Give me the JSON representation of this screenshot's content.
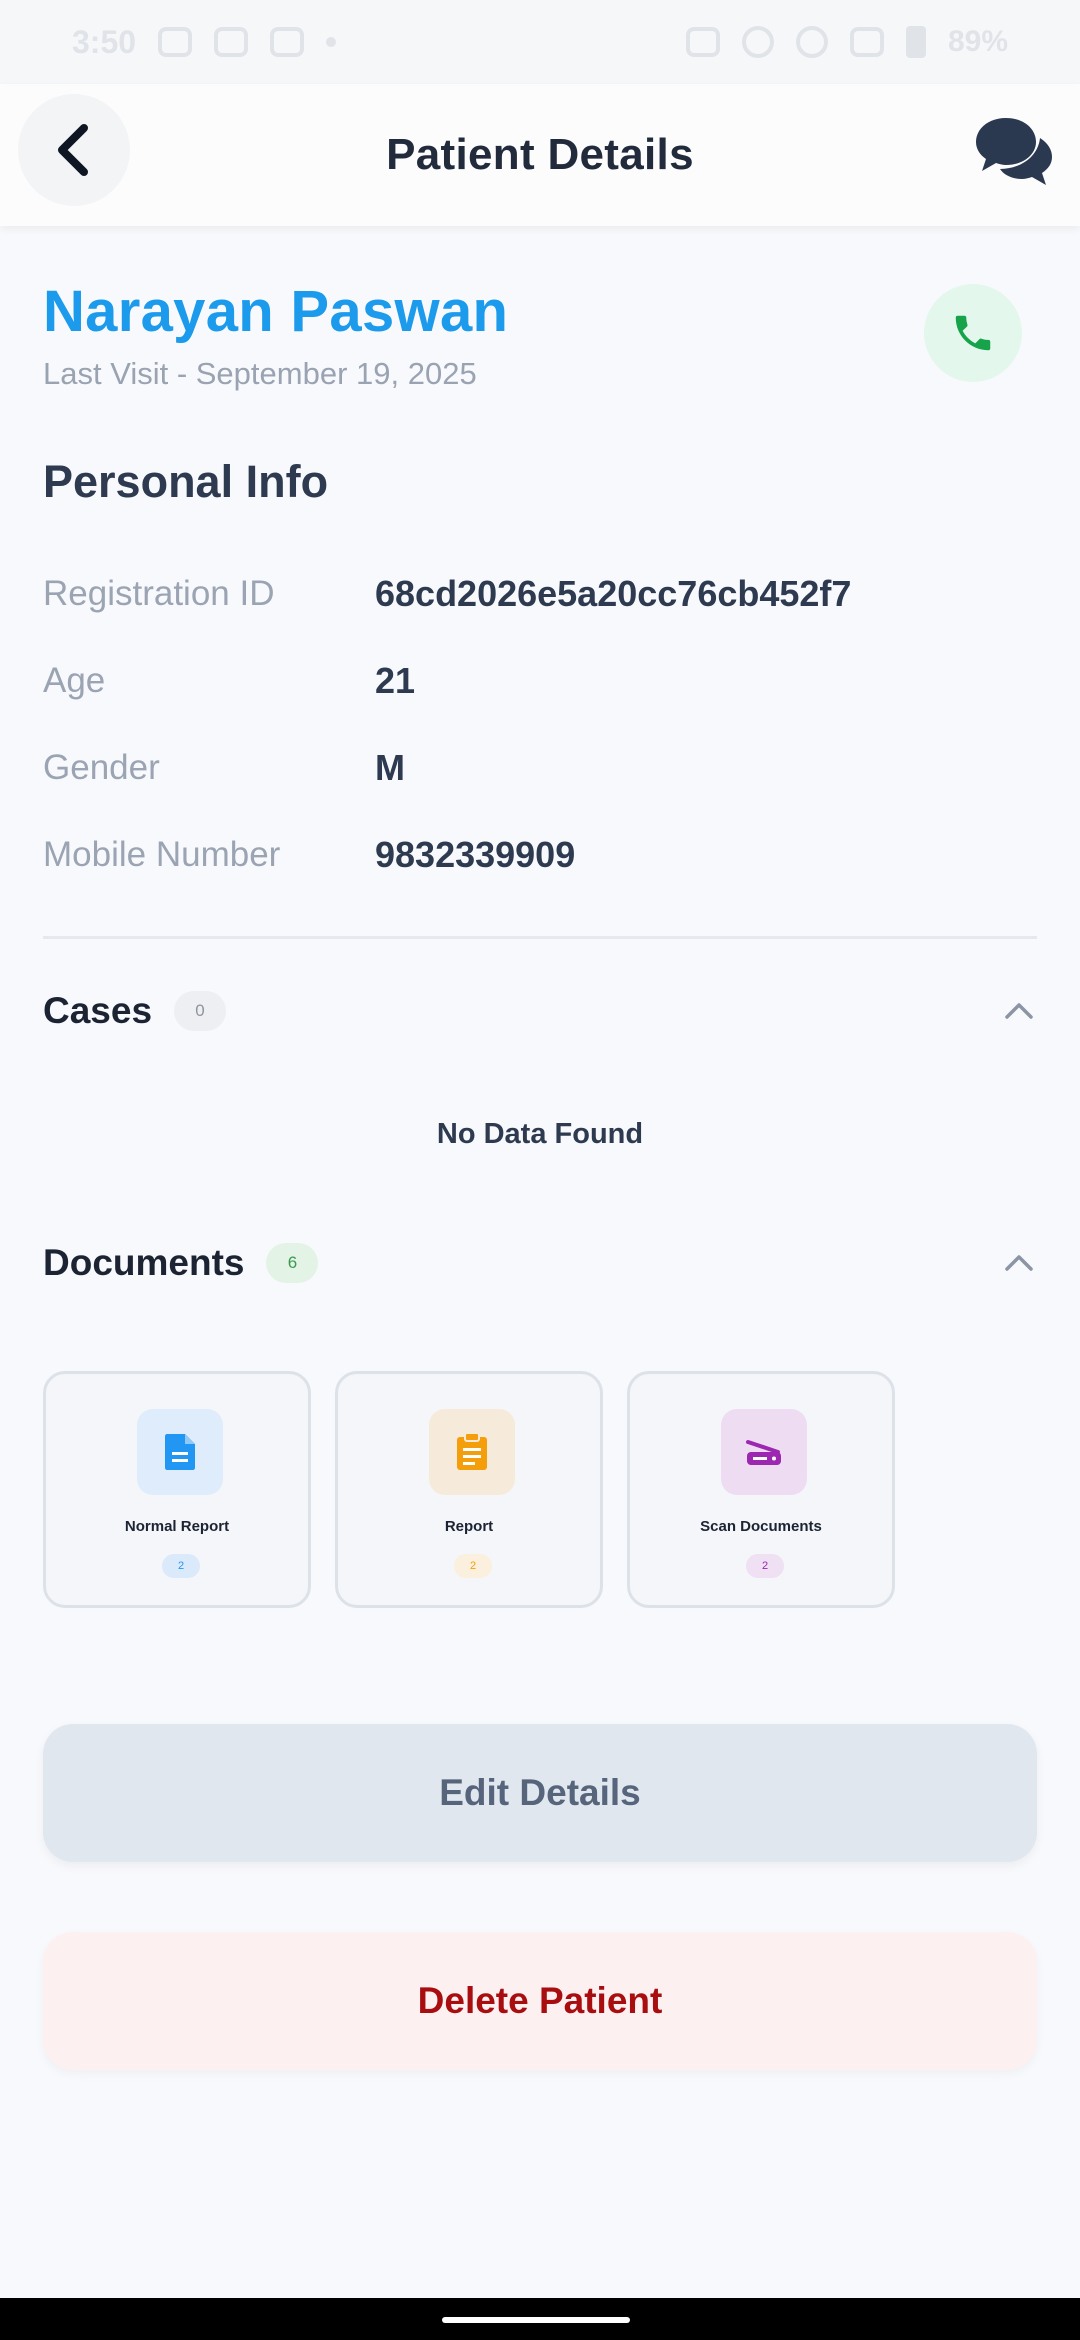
{
  "status_bar": {
    "time": "3:50",
    "battery": "89%"
  },
  "header": {
    "title": "Patient Details",
    "back_icon": "chevron-left-icon",
    "chat_icon": "chat-bubbles-icon"
  },
  "patient": {
    "name": "Narayan Paswan",
    "last_visit": "Last Visit - September 19, 2025",
    "call_icon": "phone-icon"
  },
  "personal_info": {
    "title": "Personal Info",
    "rows": [
      {
        "label": "Registration ID",
        "value": "68cd2026e5a20cc76cb452f7"
      },
      {
        "label": "Age",
        "value": "21"
      },
      {
        "label": "Gender",
        "value": "M"
      },
      {
        "label": "Mobile Number",
        "value": "9832339909"
      }
    ]
  },
  "cases": {
    "title": "Cases",
    "count": "0",
    "empty_text": "No Data Found"
  },
  "documents": {
    "title": "Documents",
    "count": "6",
    "items": [
      {
        "label": "Normal Report",
        "count": "2",
        "icon": "document-icon",
        "accent": "#2196f3",
        "bg": "#deecfb",
        "badge_bg": "#dbeafb"
      },
      {
        "label": "Report",
        "count": "2",
        "icon": "clipboard-icon",
        "accent": "#f59e0b",
        "bg": "#f6eadb",
        "badge_bg": "#fbefdd"
      },
      {
        "label": "Scan Documents",
        "count": "2",
        "icon": "scanner-icon",
        "accent": "#9c27b0",
        "bg": "#eedcf2",
        "badge_bg": "#efe0f3"
      }
    ]
  },
  "actions": {
    "edit_label": "Edit Details",
    "delete_label": "Delete Patient"
  },
  "colors": {
    "accent_blue": "#1c9aec",
    "call_green": "#16a34a",
    "delete_red": "#a80d10"
  }
}
